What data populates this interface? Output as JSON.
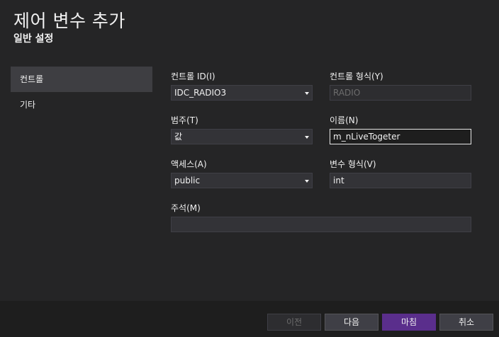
{
  "dialog": {
    "title": "제어 변수 추가",
    "subtitle": "일반 설정"
  },
  "nav": {
    "items": [
      {
        "label": "컨트롤",
        "selected": true
      },
      {
        "label": "기타",
        "selected": false
      }
    ]
  },
  "form": {
    "control_id": {
      "label": "컨트롤 ID(I)",
      "value": "IDC_RADIO3"
    },
    "control_type": {
      "label": "컨트롤 형식(Y)",
      "value": "RADIO"
    },
    "category": {
      "label": "범주(T)",
      "value": "값"
    },
    "name": {
      "label": "이름(N)",
      "value": "m_nLiveTogeter"
    },
    "access": {
      "label": "액세스(A)",
      "value": "public"
    },
    "variable_type": {
      "label": "변수 형식(V)",
      "value": "int"
    },
    "comment": {
      "label": "주석(M)",
      "value": ""
    }
  },
  "buttons": {
    "prev": "이전",
    "next": "다음",
    "finish": "마침",
    "cancel": "취소"
  },
  "colors": {
    "background": "#252526",
    "footer": "#1e1e1e",
    "accent": "#5a2e8c",
    "field": "#333337"
  }
}
